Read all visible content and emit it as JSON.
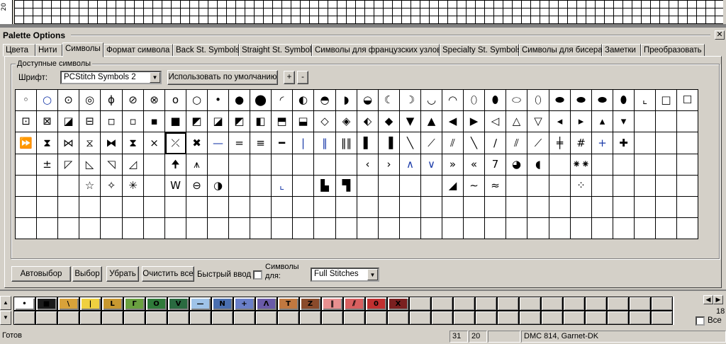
{
  "ruler_value": "20",
  "panel_title": "Palette Options",
  "close_glyph": "✕",
  "tabs": [
    {
      "label": "Цвета",
      "active": false
    },
    {
      "label": "Нити",
      "active": false
    },
    {
      "label": "Символы",
      "active": true
    },
    {
      "label": "Формат символа",
      "active": false
    },
    {
      "label": "Back St. Symbols",
      "active": false
    },
    {
      "label": "Straight St. Symbols",
      "active": false
    },
    {
      "label": "Символы для французских узлов",
      "active": false
    },
    {
      "label": "Specialty St. Symbols",
      "active": false
    },
    {
      "label": "Символы для бисера",
      "active": false
    },
    {
      "label": "Заметки",
      "active": false
    },
    {
      "label": "Преобразовать",
      "active": false
    }
  ],
  "group_label": "Доступные символы",
  "font_label": "Шрифт:",
  "font_value": "PCStitch Symbols 2",
  "default_button": "Использовать по умолчанию",
  "plus_button": "+",
  "minus_button": "-",
  "symbol_rows": [
    [
      "◦",
      "○",
      "⊙",
      "◎",
      "ϕ",
      "⊘",
      "⊗",
      "o",
      "○",
      "•",
      "●",
      "⬤",
      "◜",
      "◐",
      "◓",
      "◗",
      "◒",
      "☾",
      "☽",
      "◡",
      "◠",
      "⬯",
      "⬮",
      "⬭",
      "⬯",
      "⬬",
      "⬬",
      "⬬",
      "⬮",
      "⌞",
      "□",
      "☐"
    ],
    [
      "⊡",
      "⊠",
      "◪",
      "⊟",
      "◽",
      "▫",
      "▪",
      "■",
      "◩",
      "◪",
      "◩",
      "◧",
      "⬒",
      "⬓",
      "◇",
      "◈",
      "⬖",
      "◆",
      "▼",
      "▲",
      "◀",
      "▶",
      "◁",
      "△",
      "▽",
      "◂",
      "▸",
      "▴",
      "▾",
      "",
      "",
      ""
    ],
    [
      "⏩",
      "⧗",
      "⋈",
      "⧖",
      "⧓",
      "⧗",
      "×",
      "⤫",
      "✖",
      "—",
      "=",
      "≡",
      "━",
      "|",
      "‖",
      "‖‖",
      "▌",
      "▐",
      "╲",
      "⟋",
      "⫽",
      "╲",
      "∕",
      "⫽",
      "⟋",
      "╪",
      "#",
      "+",
      "✚",
      "",
      "",
      ""
    ],
    [
      "",
      "±",
      "◸",
      "◺",
      "◹",
      "◿",
      "",
      "🠉",
      "⩚",
      "",
      "",
      "",
      "",
      "",
      "",
      "",
      "‹",
      "›",
      "∧",
      "∨",
      "»",
      "«",
      "7",
      "◕",
      "◖",
      "",
      "⁕⁕",
      "",
      "",
      "",
      "",
      ""
    ],
    [
      "",
      "",
      "",
      "☆",
      "✧",
      "✳",
      "",
      "W",
      "⊖",
      "◑",
      "",
      "",
      "⌞",
      "",
      "▙",
      "▜",
      "",
      "",
      "",
      "",
      "◢",
      "∼",
      "≈",
      "",
      "",
      "",
      "⁘",
      "",
      "",
      "",
      "",
      ""
    ],
    [
      "",
      "",
      "",
      "",
      "",
      "",
      "",
      "",
      "",
      "",
      "",
      "",
      "",
      "",
      "",
      "",
      "",
      "",
      "",
      "",
      "",
      "",
      "",
      "",
      "",
      "",
      "",
      "",
      "",
      "",
      "",
      ""
    ],
    [
      "",
      "",
      "",
      "",
      "",
      "",
      "",
      "",
      "",
      "",
      "",
      "",
      "",
      "",
      "",
      "",
      "",
      "",
      "",
      "",
      "",
      "",
      "",
      "",
      "",
      "",
      "",
      "",
      "",
      "",
      "",
      ""
    ]
  ],
  "selected_symbol_index": [
    2,
    7
  ],
  "blue_symbols": [
    [
      0,
      1
    ],
    [
      1,
      31
    ],
    [
      2,
      9
    ],
    [
      2,
      13
    ],
    [
      2,
      14
    ],
    [
      2,
      27
    ],
    [
      3,
      18
    ],
    [
      3,
      19
    ],
    [
      4,
      12
    ]
  ],
  "auto_button": "Автовыбор",
  "select_button": "Выбор",
  "remove_button": "Убрать",
  "clear_button": "Очистить все",
  "quick_input_label": "Быстрый ввод",
  "symbols_for_label": "Символы для:",
  "stitch_type_value": "Full Stitches",
  "palette_colors": [
    {
      "color": "#ffffff",
      "symbol": "•",
      "symbol_color": "#000000"
    },
    {
      "color": "#1a1a1a",
      "symbol": "■",
      "symbol_color": "#000000"
    },
    {
      "color": "#d8a23a",
      "symbol": "\\",
      "symbol_color": "#000000"
    },
    {
      "color": "#f0d040",
      "symbol": "|",
      "symbol_color": "#000000"
    },
    {
      "color": "#c89830",
      "symbol": "L",
      "symbol_color": "#000000"
    },
    {
      "color": "#6aa040",
      "symbol": "Г",
      "symbol_color": "#000000"
    },
    {
      "color": "#2f7a3a",
      "symbol": "O",
      "symbol_color": "#000000"
    },
    {
      "color": "#2a6a40",
      "symbol": "V",
      "symbol_color": "#000000"
    },
    {
      "color": "#9fc3e8",
      "symbol": "—",
      "symbol_color": "#000000"
    },
    {
      "color": "#4a6fb0",
      "symbol": "N",
      "symbol_color": "#000000"
    },
    {
      "color": "#6a7fc8",
      "symbol": "+",
      "symbol_color": "#000000"
    },
    {
      "color": "#6a5aa8",
      "symbol": "Λ",
      "symbol_color": "#000000"
    },
    {
      "color": "#c07840",
      "symbol": "T",
      "symbol_color": "#000000"
    },
    {
      "color": "#8a4a2a",
      "symbol": "Z",
      "symbol_color": "#000000"
    },
    {
      "color": "#e89090",
      "symbol": "‖",
      "symbol_color": "#000000"
    },
    {
      "color": "#d86060",
      "symbol": "⫽",
      "symbol_color": "#000000"
    },
    {
      "color": "#c03030",
      "symbol": "0",
      "symbol_color": "#000000"
    },
    {
      "color": "#7a2020",
      "symbol": "X",
      "symbol_color": "#000000"
    }
  ],
  "palette_slots_per_row": 30,
  "palette_count": "18",
  "all_label": "Все",
  "status": {
    "ready": "Готов",
    "col": "31",
    "row": "20",
    "thread": "DMC 814, Garnet-DK"
  }
}
